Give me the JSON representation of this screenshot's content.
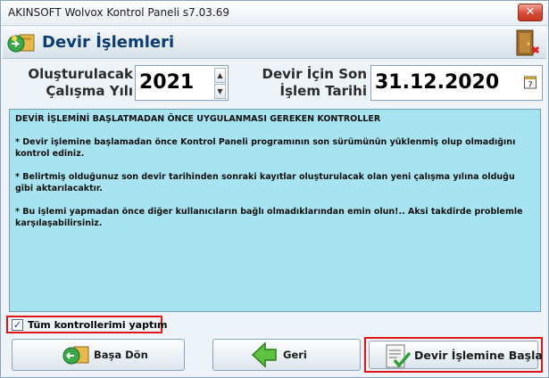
{
  "window": {
    "title": "AKINSOFT Wolvox Kontrol Paneli s7.03.69",
    "close_label": "✕"
  },
  "header": {
    "title": "Devir İşlemleri"
  },
  "form": {
    "year_label": "Oluşturulacak Çalışma Yılı",
    "year_value": "2021",
    "date_label": "Devir İçin Son İşlem Tarihi",
    "date_value": "31.12.2020",
    "calendar_day": "7"
  },
  "info": {
    "heading": "DEVİR İŞLEMİNİ BAŞLATMADAN ÖNCE UYGULANMASI GEREKEN KONTROLLER",
    "items": [
      "* Devir işlemine başlamadan önce Kontrol Paneli programının son sürümünün yüklenmiş olup olmadığını kontrol ediniz.",
      "* Belirtmiş olduğunuz son devir tarihinden sonraki kayıtlar oluşturulacak olan yeni çalışma yılına olduğu gibi aktarılacaktır.",
      "* Bu işlemi yapmadan önce diğer kullanıcıların bağlı olmadıklarından emin olun!.. Aksi takdirde problemle karşılaşabilirsiniz."
    ]
  },
  "checkbox": {
    "label": "Tüm kontrollerimi yaptım",
    "checked": true
  },
  "buttons": {
    "home": "Başa Dön",
    "back": "Geri",
    "start": "Devir İşlemine Başla"
  },
  "colors": {
    "accent_title": "#0c3b78",
    "info_bg": "#a7e3f0",
    "highlight": "#e0141b"
  }
}
